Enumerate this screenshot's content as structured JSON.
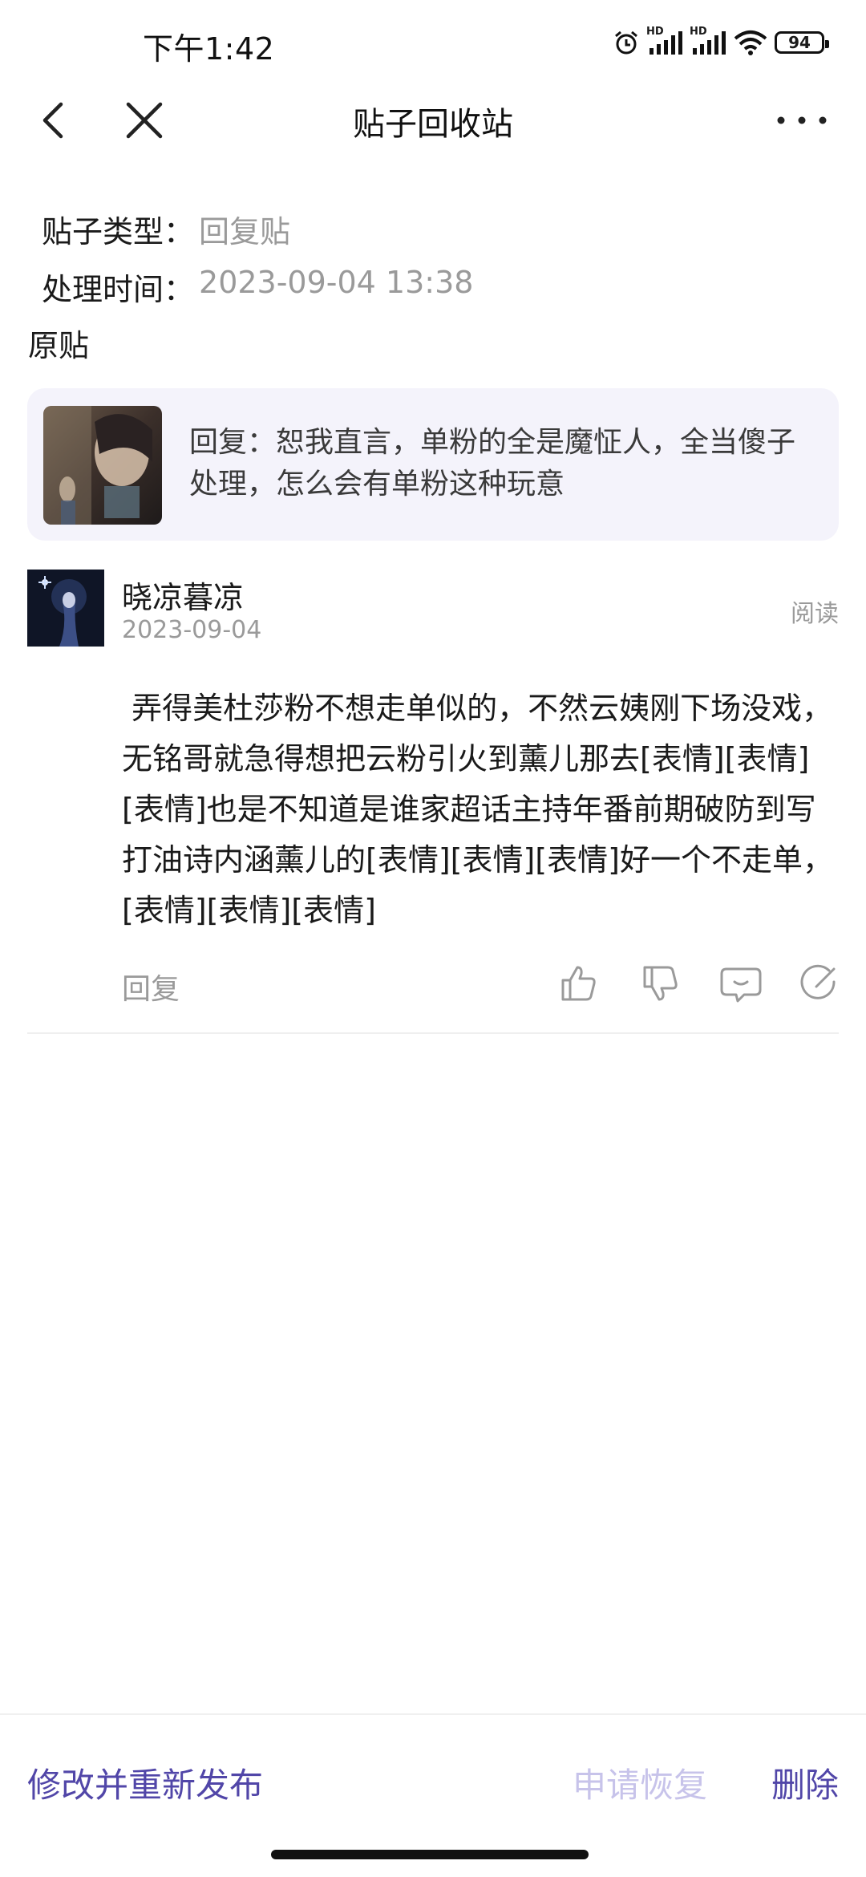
{
  "status_bar": {
    "time": "下午1:42",
    "battery": "94",
    "signal_labels": [
      "HD",
      "HD"
    ]
  },
  "nav": {
    "title": "贴子回收站"
  },
  "info": {
    "type_label": "贴子类型：",
    "type_value": "回复贴",
    "time_label": "处理时间：",
    "time_value": "2023-09-04 13:38"
  },
  "original": {
    "section_title": "原贴",
    "quote_text": "回复：恕我直言，单粉的全是魔怔人，全当傻子处理，怎么会有单粉这种玩意"
  },
  "comment": {
    "username": "晓凉暮凉",
    "date": "2023-09-04",
    "read_label": "阅读",
    "body": " 弄得美杜莎粉不想走单似的，不然云姨刚下场没戏，无铭哥就急得想把云粉引火到薰儿那去[表情][表情][表情]也是不知道是谁家超话主持年番前期破防到写打油诗内涵薰儿的[表情][表情][表情]好一个不走单，[表情][表情][表情]",
    "reply_label": "回复",
    "actions": [
      "like-icon",
      "dislike-icon",
      "comment-icon",
      "share-icon"
    ]
  },
  "bottom_bar": {
    "republish": "修改并重新发布",
    "restore": "申请恢复",
    "delete": "删除"
  },
  "colors": {
    "accent": "#5146a8",
    "accent_disabled": "#c7c3ea",
    "card_bg": "#f4f3fb",
    "muted_text": "#9a9a9a"
  }
}
